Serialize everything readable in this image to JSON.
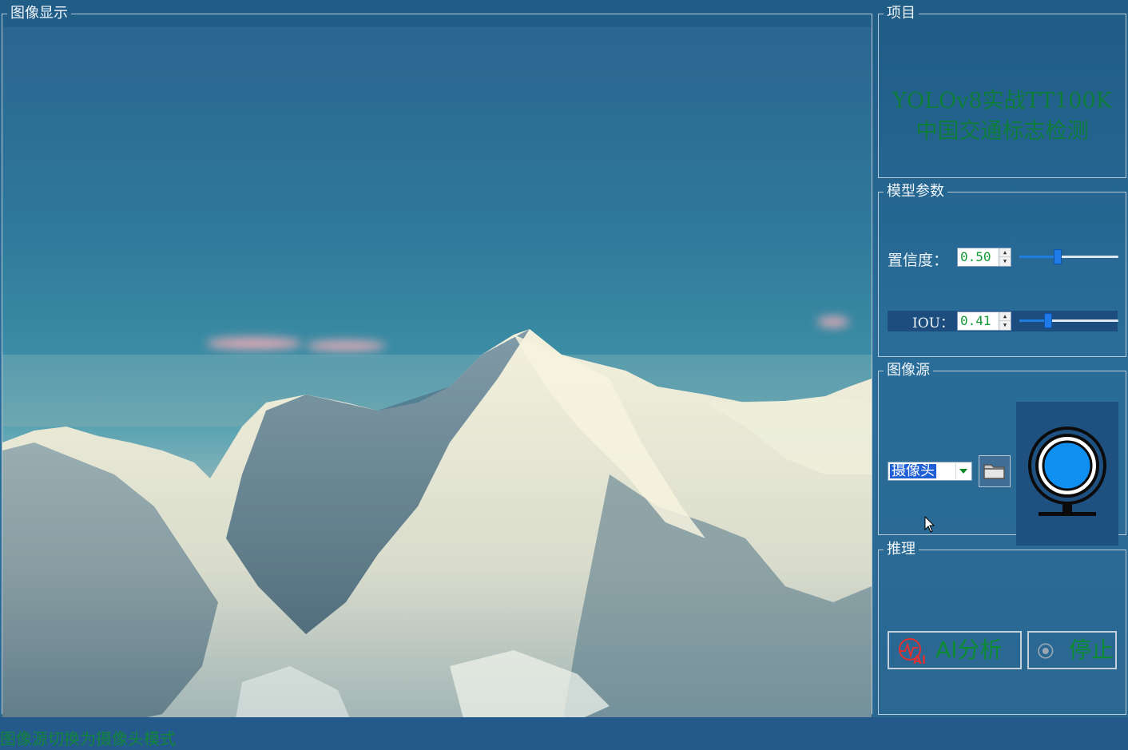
{
  "display": {
    "legend": "图像显示"
  },
  "project": {
    "legend": "项目",
    "title_line1": "YOLOv8实战TT100K",
    "title_line2": "中国交通标志检测"
  },
  "params": {
    "legend": "模型参数",
    "confidence": {
      "label": "置信度：",
      "value": "0.50",
      "slider_fraction": 0.38
    },
    "iou": {
      "label": "IOU：",
      "value": "0.41",
      "slider_fraction": 0.27
    }
  },
  "source": {
    "legend": "图像源",
    "select_value": "摄像头",
    "folder_icon": "folder-icon",
    "camera_icon": "webcam-icon"
  },
  "infer": {
    "legend": "推理",
    "ai_button": "AI分析",
    "stop_button": "停止",
    "ai_icon_text": "AI"
  },
  "status": {
    "text": "图像源切换为摄像头模式"
  },
  "colors": {
    "background": "#2a6791",
    "accent_green": "#0f7d3a",
    "accent_blue": "#1e7be8"
  }
}
